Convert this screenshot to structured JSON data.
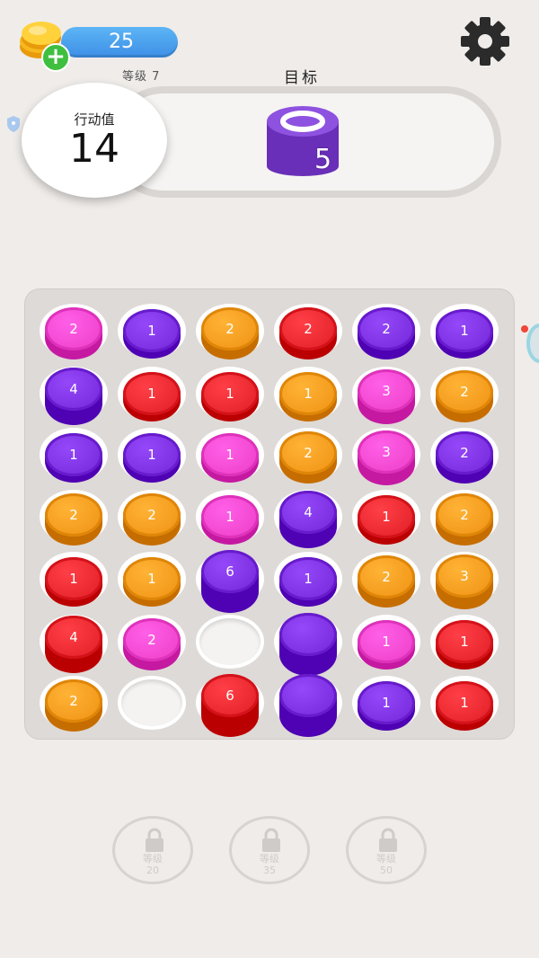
{
  "currency": {
    "amount": "25"
  },
  "header": {
    "level_label": "等级 7",
    "goal_label": "目标"
  },
  "moves": {
    "title": "行动值",
    "value": "14"
  },
  "goal": {
    "color": "#7a3fc9",
    "count": "5"
  },
  "colors": {
    "pink": "#f246cf",
    "purple": "#7b2fe0",
    "orange": "#f39a1c",
    "red": "#e8262e",
    "empty": "#ffffff"
  },
  "board": {
    "rows": [
      [
        {
          "c": "pink",
          "n": "2"
        },
        {
          "c": "purple",
          "n": "1"
        },
        {
          "c": "orange",
          "n": "2"
        },
        {
          "c": "red",
          "n": "2"
        },
        {
          "c": "purple",
          "n": "2"
        },
        {
          "c": "purple",
          "n": "1"
        }
      ],
      [
        {
          "c": "purple",
          "n": "4"
        },
        {
          "c": "red",
          "n": "1"
        },
        {
          "c": "red",
          "n": "1"
        },
        {
          "c": "orange",
          "n": "1"
        },
        {
          "c": "pink",
          "n": "3"
        },
        {
          "c": "orange",
          "n": "2"
        }
      ],
      [
        {
          "c": "purple",
          "n": "1"
        },
        {
          "c": "purple",
          "n": "1"
        },
        {
          "c": "pink",
          "n": "1"
        },
        {
          "c": "orange",
          "n": "2"
        },
        {
          "c": "pink",
          "n": "3"
        },
        {
          "c": "purple",
          "n": "2"
        }
      ],
      [
        {
          "c": "orange",
          "n": "2"
        },
        {
          "c": "orange",
          "n": "2"
        },
        {
          "c": "pink",
          "n": "1"
        },
        {
          "c": "purple",
          "n": "4"
        },
        {
          "c": "red",
          "n": "1"
        },
        {
          "c": "orange",
          "n": "2"
        }
      ],
      [
        {
          "c": "red",
          "n": "1"
        },
        {
          "c": "orange",
          "n": "1"
        },
        {
          "c": "purple",
          "n": "6"
        },
        {
          "c": "purple",
          "n": "1"
        },
        {
          "c": "orange",
          "n": "2"
        },
        {
          "c": "orange",
          "n": "3"
        }
      ],
      [
        {
          "c": "red",
          "n": "4"
        },
        {
          "c": "pink",
          "n": "2"
        },
        {
          "c": "empty",
          "n": ""
        },
        {
          "c": "purple",
          "n": ""
        },
        {
          "c": "pink",
          "n": "1"
        },
        {
          "c": "red",
          "n": "1"
        }
      ],
      [
        {
          "c": "orange",
          "n": "2"
        },
        {
          "c": "empty",
          "n": ""
        },
        {
          "c": "red",
          "n": "6"
        },
        {
          "c": "purple",
          "n": ""
        },
        {
          "c": "purple",
          "n": "1"
        },
        {
          "c": "red",
          "n": "1"
        }
      ]
    ]
  },
  "locked_slots": [
    {
      "label": "等级",
      "level": "20"
    },
    {
      "label": "等级",
      "level": "35"
    },
    {
      "label": "等级",
      "level": "50"
    }
  ]
}
